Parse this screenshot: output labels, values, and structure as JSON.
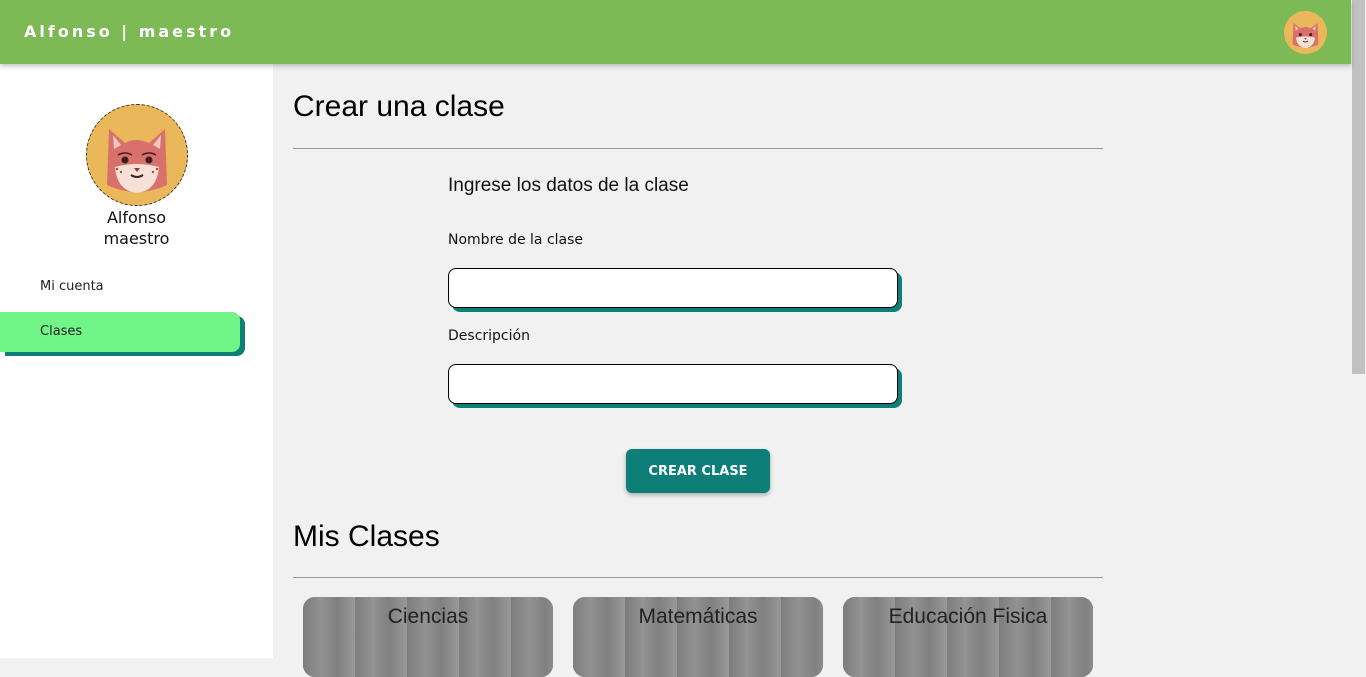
{
  "header": {
    "brand": "Alfonso | maestro",
    "avatar_icon": "cat-avatar-icon"
  },
  "sidebar": {
    "avatar_icon": "cat-avatar-icon",
    "user_first": "Alfonso",
    "user_last": "maestro",
    "items": [
      {
        "label": "Mi cuenta",
        "active": false
      },
      {
        "label": "Clases",
        "active": true
      }
    ]
  },
  "create": {
    "title": "Crear una clase",
    "subtitle": "Ingrese los datos de la clase",
    "name_label": "Nombre de la clase",
    "name_value": "",
    "description_label": "Descripción",
    "description_value": "",
    "button_label": "CREAR CLASE"
  },
  "my_classes": {
    "title": "Mis Clases",
    "cards": [
      {
        "name": "Ciencias"
      },
      {
        "name": "Matemáticas"
      },
      {
        "name": "Educación Fisica"
      }
    ]
  },
  "colors": {
    "header": "#7dba55",
    "accent": "#0e7f78",
    "active_item": "#72f587",
    "avatar_bg": "#eab85a"
  }
}
